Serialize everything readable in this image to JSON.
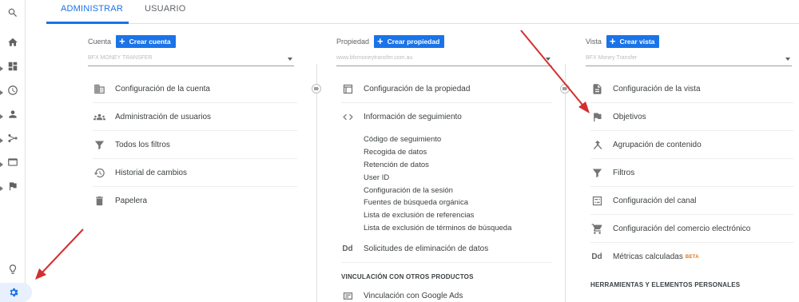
{
  "tabs": {
    "admin": "ADMINISTRAR",
    "user": "USUARIO"
  },
  "account": {
    "label": "Cuenta",
    "create": "Crear cuenta",
    "selected": "BFX MONEY TRANSFER",
    "items": [
      "Configuración de la cuenta",
      "Administración de usuarios",
      "Todos los filtros",
      "Historial de cambios",
      "Papelera"
    ]
  },
  "property": {
    "label": "Propiedad",
    "create": "Crear propiedad",
    "selected": "www.bfxmoneytransfer.com.au",
    "items": [
      "Configuración de la propiedad",
      "Información de seguimiento"
    ],
    "tracking_sub": [
      "Código de seguimiento",
      "Recogida de datos",
      "Retención de datos",
      "User ID",
      "Configuración de la sesión",
      "Fuentes de búsqueda orgánica",
      "Lista de exclusión de referencias",
      "Lista de exclusión de términos de búsqueda"
    ],
    "deletion": "Solicitudes de eliminación de datos",
    "linking_head": "VINCULACIÓN CON OTROS PRODUCTOS",
    "google_ads": "Vinculación con Google Ads"
  },
  "view": {
    "label": "Vista",
    "create": "Crear vista",
    "selected": "BFX Money Transfer",
    "items": [
      "Configuración de la vista",
      "Objetivos",
      "Agrupación de contenido",
      "Filtros",
      "Configuración del canal",
      "Configuración del comercio electrónico",
      "Métricas calculadas"
    ],
    "beta": "BETA",
    "tools_head": "HERRAMIENTAS Y ELEMENTOS PERSONALES"
  },
  "icon_text": {
    "dd": "Dd"
  },
  "colors": {
    "accent": "#1a73e8",
    "annotation": "#d32f2f",
    "beta": "#e8710a"
  }
}
